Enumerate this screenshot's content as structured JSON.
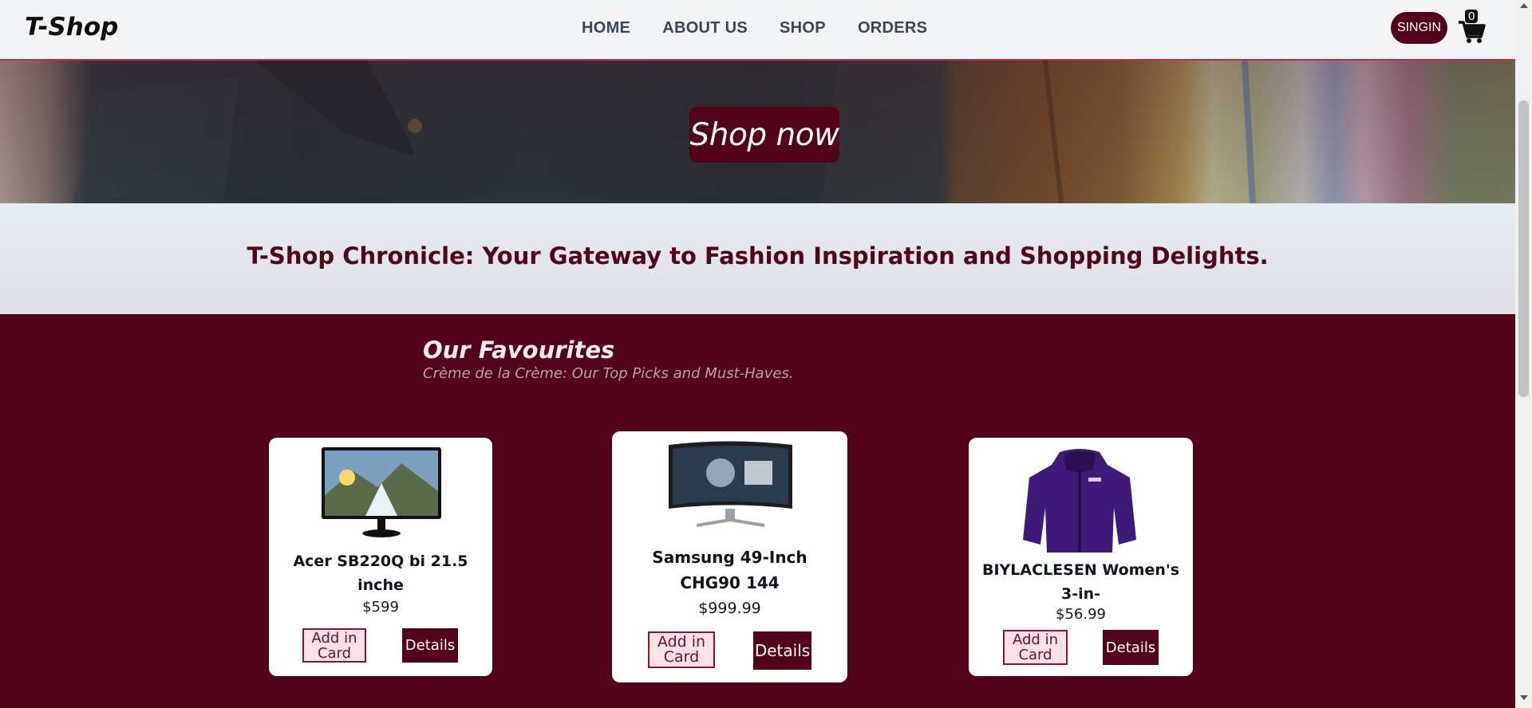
{
  "header": {
    "logo": "T-Shop",
    "nav": [
      "HOME",
      "ABOUT US",
      "SHOP",
      "ORDERS"
    ],
    "signin_label": "SINGIN",
    "cart_count": "0"
  },
  "hero": {
    "cta_label": "Shop now"
  },
  "chronicle": {
    "headline": "T-Shop Chronicle: Your Gateway to Fashion Inspiration and Shopping Delights."
  },
  "favourites": {
    "title": "Our Favourites",
    "subtitle": "Crème de la Crème: Our Top Picks and Must-Haves.",
    "products": [
      {
        "name": "Acer SB220Q bi 21.5 inche",
        "price": "$599",
        "add_label": "Add in Card",
        "details_label": "Details",
        "image_icon": "monitor-landscape-image"
      },
      {
        "name": "Samsung 49-Inch CHG90 144",
        "price": "$999.99",
        "add_label": "Add in Card",
        "details_label": "Details",
        "image_icon": "curved-monitor-image"
      },
      {
        "name": "BIYLACLESEN Women's 3-in-",
        "price": "$56.99",
        "add_label": "Add in Card",
        "details_label": "Details",
        "image_icon": "purple-jacket-image"
      }
    ]
  },
  "colors": {
    "brand": "#520319",
    "header_bg": "#f3f4f6",
    "accent_border": "#b3324f"
  }
}
